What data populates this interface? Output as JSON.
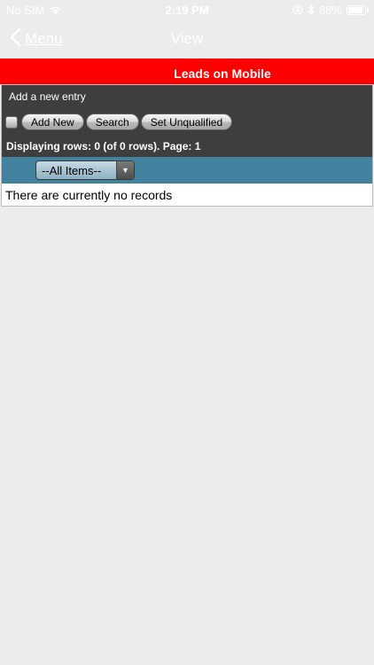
{
  "status_bar": {
    "carrier": "No SIM",
    "time": "2:19 PM",
    "battery_percent_label": "88%",
    "battery_level": 0.88
  },
  "nav": {
    "back_label": "Menu",
    "title": "View"
  },
  "header": {
    "title": "Leads on Mobile"
  },
  "panel": {
    "caption": "Add a new entry",
    "buttons": {
      "add_new": "Add New",
      "search": "Search",
      "set_unqualified": "Set Unqualified"
    },
    "rows_info": "Displaying rows: 0 (of 0 rows). Page: 1"
  },
  "filter": {
    "selected": "--All Items--"
  },
  "records": {
    "empty_message": "There are currently no records"
  },
  "colors": {
    "header_red": "#ff0000",
    "panel_dark": "#3e3e3e",
    "filter_teal": "#43829e",
    "background": "#ececec"
  }
}
